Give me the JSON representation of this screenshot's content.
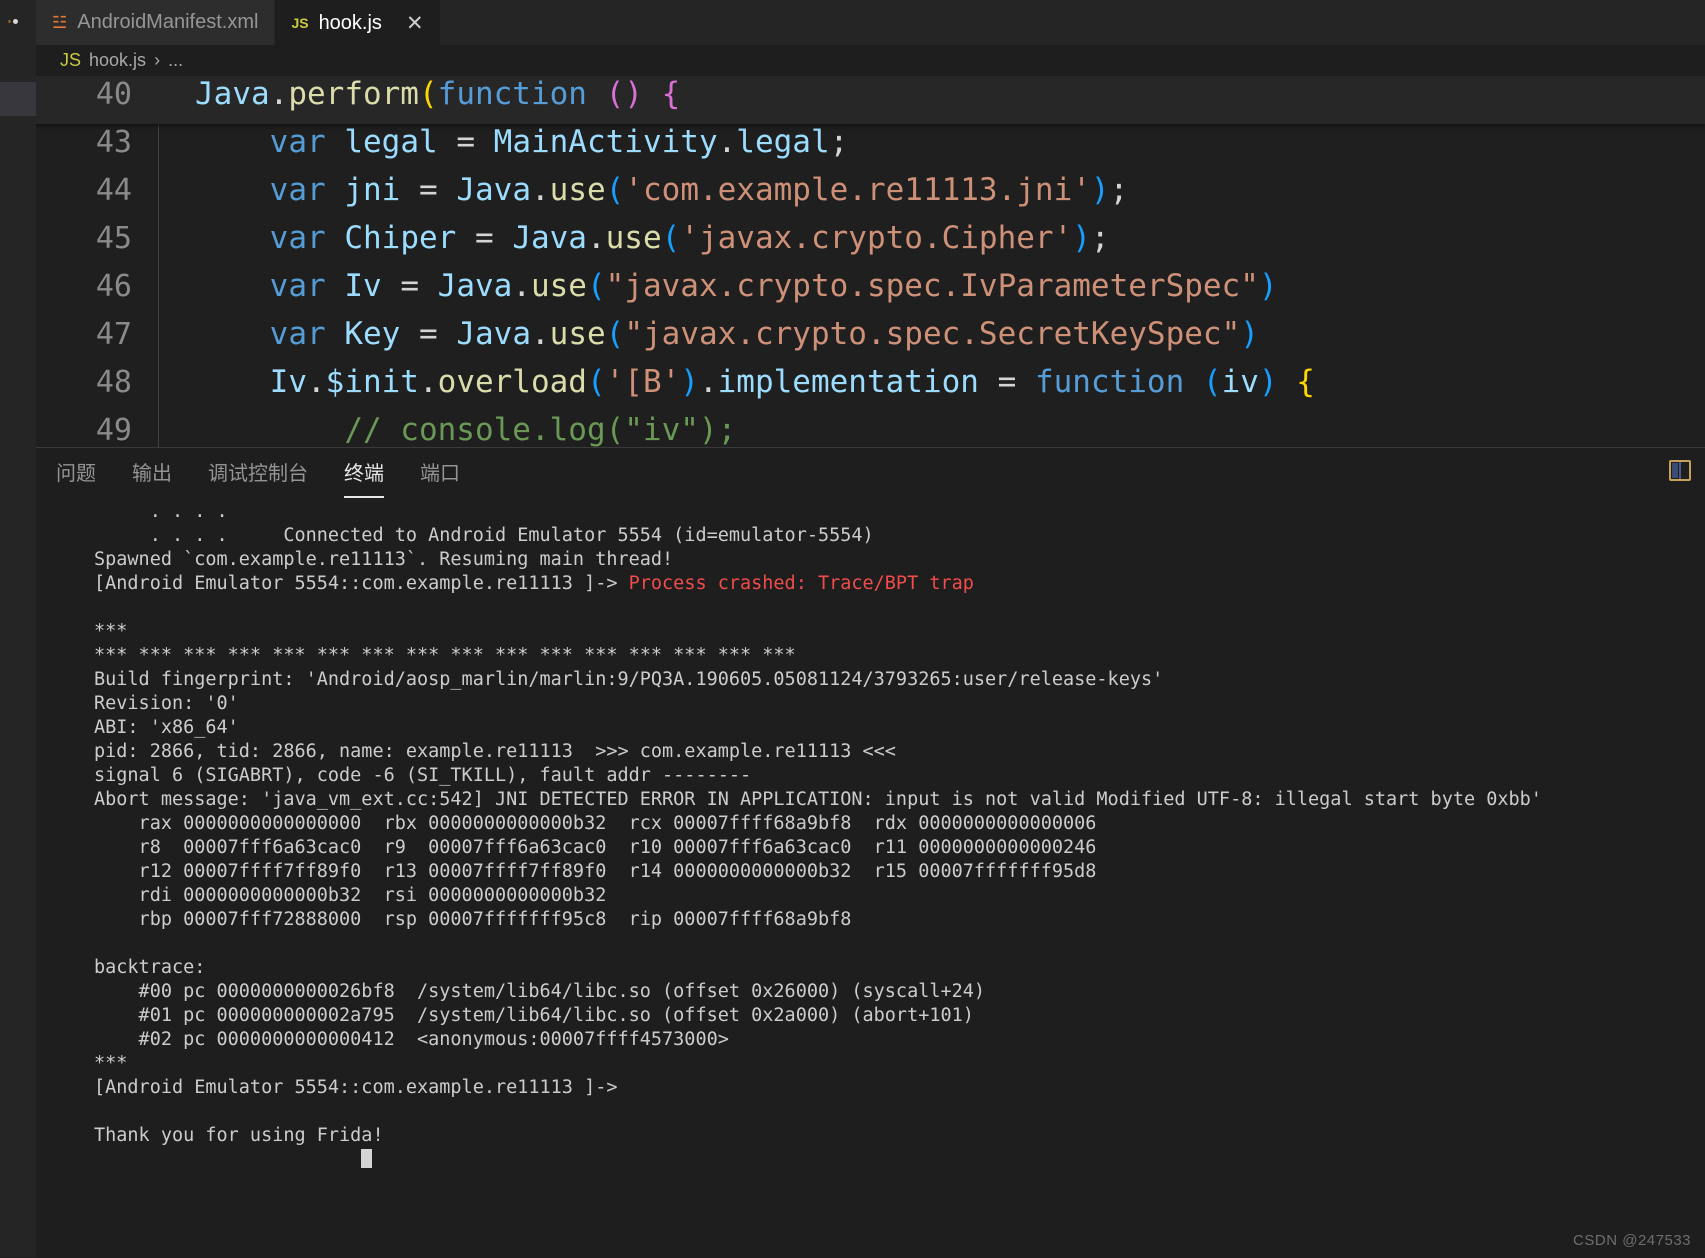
{
  "window": {
    "background": "#1e1e1e",
    "accent": "#569cd6"
  },
  "tabs": [
    {
      "icon": "xml-file-icon",
      "icon_label": "XML",
      "label": "AndroidManifest.xml",
      "active": false
    },
    {
      "icon": "js-file-icon",
      "icon_label": "JS",
      "label": "hook.js",
      "active": true,
      "close_label": "✕"
    }
  ],
  "breadcrumb": {
    "icon_label": "JS",
    "file": "hook.js",
    "separator": "›",
    "tail": "..."
  },
  "editor": {
    "lines": [
      {
        "number": "40",
        "sticky": true,
        "indent_guide": false,
        "tokens": [
          {
            "text": "Java",
            "cls": "t-id"
          },
          {
            "text": ".",
            "cls": "t-plain"
          },
          {
            "text": "perform",
            "cls": "t-fn"
          },
          {
            "text": "(",
            "cls": "t-paren"
          },
          {
            "text": "function",
            "cls": "t-var"
          },
          {
            "text": " ",
            "cls": "t-plain"
          },
          {
            "text": "()",
            "cls": "t-paren2"
          },
          {
            "text": " ",
            "cls": "t-plain"
          },
          {
            "text": "{",
            "cls": "t-paren2"
          }
        ]
      },
      {
        "number": "43",
        "sticky": false,
        "indent_guide": true,
        "tokens": [
          {
            "text": "    ",
            "cls": "t-plain"
          },
          {
            "text": "var",
            "cls": "t-var"
          },
          {
            "text": " ",
            "cls": "t-plain"
          },
          {
            "text": "legal",
            "cls": "t-id"
          },
          {
            "text": " = ",
            "cls": "t-plain"
          },
          {
            "text": "MainActivity",
            "cls": "t-id"
          },
          {
            "text": ".",
            "cls": "t-plain"
          },
          {
            "text": "legal",
            "cls": "t-id"
          },
          {
            "text": ";",
            "cls": "t-plain"
          }
        ]
      },
      {
        "number": "44",
        "sticky": false,
        "indent_guide": true,
        "tokens": [
          {
            "text": "    ",
            "cls": "t-plain"
          },
          {
            "text": "var",
            "cls": "t-var"
          },
          {
            "text": " ",
            "cls": "t-plain"
          },
          {
            "text": "jni",
            "cls": "t-id"
          },
          {
            "text": " = ",
            "cls": "t-plain"
          },
          {
            "text": "Java",
            "cls": "t-id"
          },
          {
            "text": ".",
            "cls": "t-plain"
          },
          {
            "text": "use",
            "cls": "t-fn"
          },
          {
            "text": "(",
            "cls": "t-paren3"
          },
          {
            "text": "'com.example.re11113.jni'",
            "cls": "t-str"
          },
          {
            "text": ")",
            "cls": "t-paren3"
          },
          {
            "text": ";",
            "cls": "t-plain"
          }
        ]
      },
      {
        "number": "45",
        "sticky": false,
        "indent_guide": true,
        "tokens": [
          {
            "text": "    ",
            "cls": "t-plain"
          },
          {
            "text": "var",
            "cls": "t-var"
          },
          {
            "text": " ",
            "cls": "t-plain"
          },
          {
            "text": "Chiper",
            "cls": "t-id"
          },
          {
            "text": " = ",
            "cls": "t-plain"
          },
          {
            "text": "Java",
            "cls": "t-id"
          },
          {
            "text": ".",
            "cls": "t-plain"
          },
          {
            "text": "use",
            "cls": "t-fn"
          },
          {
            "text": "(",
            "cls": "t-paren3"
          },
          {
            "text": "'javax.crypto.Cipher'",
            "cls": "t-str"
          },
          {
            "text": ")",
            "cls": "t-paren3"
          },
          {
            "text": ";",
            "cls": "t-plain"
          }
        ]
      },
      {
        "number": "46",
        "sticky": false,
        "indent_guide": true,
        "tokens": [
          {
            "text": "    ",
            "cls": "t-plain"
          },
          {
            "text": "var",
            "cls": "t-var"
          },
          {
            "text": " ",
            "cls": "t-plain"
          },
          {
            "text": "Iv",
            "cls": "t-id"
          },
          {
            "text": " = ",
            "cls": "t-plain"
          },
          {
            "text": "Java",
            "cls": "t-id"
          },
          {
            "text": ".",
            "cls": "t-plain"
          },
          {
            "text": "use",
            "cls": "t-fn"
          },
          {
            "text": "(",
            "cls": "t-paren3"
          },
          {
            "text": "\"javax.crypto.spec.IvParameterSpec\"",
            "cls": "t-str"
          },
          {
            "text": ")",
            "cls": "t-paren3"
          }
        ]
      },
      {
        "number": "47",
        "sticky": false,
        "indent_guide": true,
        "tokens": [
          {
            "text": "    ",
            "cls": "t-plain"
          },
          {
            "text": "var",
            "cls": "t-var"
          },
          {
            "text": " ",
            "cls": "t-plain"
          },
          {
            "text": "Key",
            "cls": "t-id"
          },
          {
            "text": " = ",
            "cls": "t-plain"
          },
          {
            "text": "Java",
            "cls": "t-id"
          },
          {
            "text": ".",
            "cls": "t-plain"
          },
          {
            "text": "use",
            "cls": "t-fn"
          },
          {
            "text": "(",
            "cls": "t-paren3"
          },
          {
            "text": "\"javax.crypto.spec.SecretKeySpec\"",
            "cls": "t-str"
          },
          {
            "text": ")",
            "cls": "t-paren3"
          }
        ]
      },
      {
        "number": "48",
        "sticky": false,
        "indent_guide": true,
        "tokens": [
          {
            "text": "    ",
            "cls": "t-plain"
          },
          {
            "text": "Iv",
            "cls": "t-id"
          },
          {
            "text": ".",
            "cls": "t-plain"
          },
          {
            "text": "$init",
            "cls": "t-id"
          },
          {
            "text": ".",
            "cls": "t-plain"
          },
          {
            "text": "overload",
            "cls": "t-fn"
          },
          {
            "text": "(",
            "cls": "t-paren3"
          },
          {
            "text": "'[B'",
            "cls": "t-str"
          },
          {
            "text": ")",
            "cls": "t-paren3"
          },
          {
            "text": ".",
            "cls": "t-plain"
          },
          {
            "text": "implementation",
            "cls": "t-id"
          },
          {
            "text": " = ",
            "cls": "t-plain"
          },
          {
            "text": "function",
            "cls": "t-var"
          },
          {
            "text": " ",
            "cls": "t-plain"
          },
          {
            "text": "(",
            "cls": "t-paren3"
          },
          {
            "text": "iv",
            "cls": "t-id"
          },
          {
            "text": ")",
            "cls": "t-paren3"
          },
          {
            "text": " ",
            "cls": "t-plain"
          },
          {
            "text": "{",
            "cls": "t-paren"
          }
        ]
      },
      {
        "number": "49",
        "sticky": false,
        "indent_guide": true,
        "tokens": [
          {
            "text": "        ",
            "cls": "t-plain"
          },
          {
            "text": "// console.log(\"iv\");",
            "cls": "t-com"
          }
        ]
      }
    ]
  },
  "panel": {
    "tabs": [
      {
        "label": "问题",
        "active": false
      },
      {
        "label": "输出",
        "active": false
      },
      {
        "label": "调试控制台",
        "active": false
      },
      {
        "label": "终端",
        "active": true
      },
      {
        "label": "端口",
        "active": false
      }
    ],
    "actions": [
      {
        "icon": "split-panel-layout-icon"
      }
    ]
  },
  "terminal": {
    "lines": [
      {
        "segments": [
          {
            "text": "     . . . .",
            "cls": ""
          }
        ]
      },
      {
        "segments": [
          {
            "text": "     . . . .     Connected to Android Emulator 5554 (id=emulator-5554)",
            "cls": ""
          }
        ]
      },
      {
        "segments": [
          {
            "text": "Spawned `com.example.re11113`. Resuming main thread!",
            "cls": ""
          }
        ]
      },
      {
        "segments": [
          {
            "text": "[Android Emulator 5554::com.example.re11113 ]-> ",
            "cls": ""
          },
          {
            "text": "Process crashed: Trace/BPT trap",
            "cls": "red"
          }
        ]
      },
      {
        "segments": [
          {
            "text": "",
            "cls": ""
          }
        ]
      },
      {
        "segments": [
          {
            "text": "***",
            "cls": ""
          }
        ]
      },
      {
        "segments": [
          {
            "text": "*** *** *** *** *** *** *** *** *** *** *** *** *** *** *** ***",
            "cls": ""
          }
        ]
      },
      {
        "segments": [
          {
            "text": "Build fingerprint: 'Android/aosp_marlin/marlin:9/PQ3A.190605.05081124/3793265:user/release-keys'",
            "cls": ""
          }
        ]
      },
      {
        "segments": [
          {
            "text": "Revision: '0'",
            "cls": ""
          }
        ]
      },
      {
        "segments": [
          {
            "text": "ABI: 'x86_64'",
            "cls": ""
          }
        ]
      },
      {
        "segments": [
          {
            "text": "pid: 2866, tid: 2866, name: example.re11113  >>> com.example.re11113 <<<",
            "cls": ""
          }
        ]
      },
      {
        "segments": [
          {
            "text": "signal 6 (SIGABRT), code -6 (SI_TKILL), fault addr --------",
            "cls": ""
          }
        ]
      },
      {
        "segments": [
          {
            "text": "Abort message: 'java_vm_ext.cc:542] JNI DETECTED ERROR IN APPLICATION: input is not valid Modified UTF-8: illegal start byte 0xbb'",
            "cls": ""
          }
        ]
      },
      {
        "segments": [
          {
            "text": "    rax 0000000000000000  rbx 0000000000000b32  rcx 00007ffff68a9bf8  rdx 0000000000000006",
            "cls": ""
          }
        ]
      },
      {
        "segments": [
          {
            "text": "    r8  00007fff6a63cac0  r9  00007fff6a63cac0  r10 00007fff6a63cac0  r11 0000000000000246",
            "cls": ""
          }
        ]
      },
      {
        "segments": [
          {
            "text": "    r12 00007ffff7ff89f0  r13 00007ffff7ff89f0  r14 0000000000000b32  r15 00007fffffff95d8",
            "cls": ""
          }
        ]
      },
      {
        "segments": [
          {
            "text": "    rdi 0000000000000b32  rsi 0000000000000b32",
            "cls": ""
          }
        ]
      },
      {
        "segments": [
          {
            "text": "    rbp 00007fff72888000  rsp 00007fffffff95c8  rip 00007ffff68a9bf8",
            "cls": ""
          }
        ]
      },
      {
        "segments": [
          {
            "text": "",
            "cls": ""
          }
        ]
      },
      {
        "segments": [
          {
            "text": "backtrace:",
            "cls": ""
          }
        ]
      },
      {
        "segments": [
          {
            "text": "    #00 pc 0000000000026bf8  /system/lib64/libc.so (offset 0x26000) (syscall+24)",
            "cls": ""
          }
        ]
      },
      {
        "segments": [
          {
            "text": "    #01 pc 000000000002a795  /system/lib64/libc.so (offset 0x2a000) (abort+101)",
            "cls": ""
          }
        ]
      },
      {
        "segments": [
          {
            "text": "    #02 pc 0000000000000412  <anonymous:00007ffff4573000>",
            "cls": ""
          }
        ]
      },
      {
        "segments": [
          {
            "text": "***",
            "cls": ""
          }
        ]
      },
      {
        "segments": [
          {
            "text": "[Android Emulator 5554::com.example.re11113 ]->",
            "cls": ""
          }
        ]
      },
      {
        "segments": [
          {
            "text": "",
            "cls": ""
          }
        ]
      },
      {
        "segments": [
          {
            "text": "Thank you for using Frida!",
            "cls": ""
          }
        ]
      }
    ],
    "cursor_visible": true
  },
  "watermark": {
    "text": "CSDN @247533"
  }
}
